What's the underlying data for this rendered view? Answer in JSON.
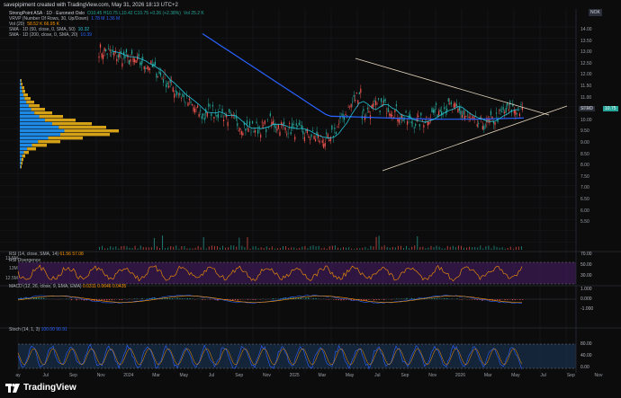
{
  "credit": "savepipiment created with TradingView.com, May 31, 2026 18:13 UTC+2",
  "currency": "NOK",
  "main_legend": {
    "title": "StrongPoint ASA · 1D · Euronext Oslo",
    "ohlc": "O10.45 H10.75 L10.42 C10.75 +0.26 (+2.38%)",
    "vol": "Vol 25.2 K",
    "vrvp": "VRVP (Number Of Rows, 30, Up/Down)",
    "vrvp_vals": "1.78 M  1.36 M",
    "vol20": "Vol (20)",
    "vol20_vals": "58.52 K  66.95 K",
    "sma50": "SMA · 1D (50, close, 0, SMA, 50)",
    "sma50_val": "10.32",
    "sma200": "SMA · 1D (200, close, 0, SMA, 20)",
    "sma200_val": "10.39"
  },
  "symbol_tag": "STRO",
  "last_price": "10.75",
  "price_axis": [
    "14.00",
    "13.50",
    "13.00",
    "12.50",
    "12.00",
    "11.50",
    "11.00",
    "10.50",
    "10.00",
    "9.50",
    "9.00",
    "8.50",
    "8.00",
    "7.50",
    "7.00",
    "6.50",
    "6.00",
    "5.50"
  ],
  "volume_axis": [
    "13.5M",
    "13M",
    "12.5M"
  ],
  "rsi": {
    "label": "RSI (14, close, SMA, 14)",
    "vals": "61.56  57.08",
    "sub": "RSI Divergence",
    "axis": [
      "70.00",
      "50.00",
      "30.00"
    ]
  },
  "macd": {
    "label": "MACD (12, 26, close, 9, EMA, EMA)",
    "vals": "0.0311  0.0646  0.0435",
    "axis": [
      "1.000",
      "0.000",
      "-1.000"
    ]
  },
  "stoch": {
    "label": "Stoch (14, 1, 3)",
    "vals": "100.00  90.91",
    "axis": [
      "80.00",
      "40.00",
      "0.00"
    ]
  },
  "x_axis": [
    "ay",
    "Jul",
    "Sep",
    "Nov",
    "2024",
    "Mar",
    "May",
    "Jul",
    "Sep",
    "Nov",
    "2025",
    "Mar",
    "May",
    "Jul",
    "Sep",
    "Nov",
    "2026",
    "Mar",
    "May",
    "Jul",
    "Sep",
    "Nov"
  ],
  "brand": "TradingView",
  "colors": {
    "bg": "#0c0c0c",
    "sma200": "#2962ff",
    "sma50": "#26c6da",
    "up": "#26a69a",
    "down": "#ef5350",
    "vrvp_up": "#1e88e5",
    "vrvp_down": "#d4a017",
    "rsi": "#ff9800",
    "rsi_band": "#4a1f6e",
    "stoch_k": "#2962ff",
    "stoch_d": "#ff9800",
    "triangle": "#e8d8c0"
  }
}
